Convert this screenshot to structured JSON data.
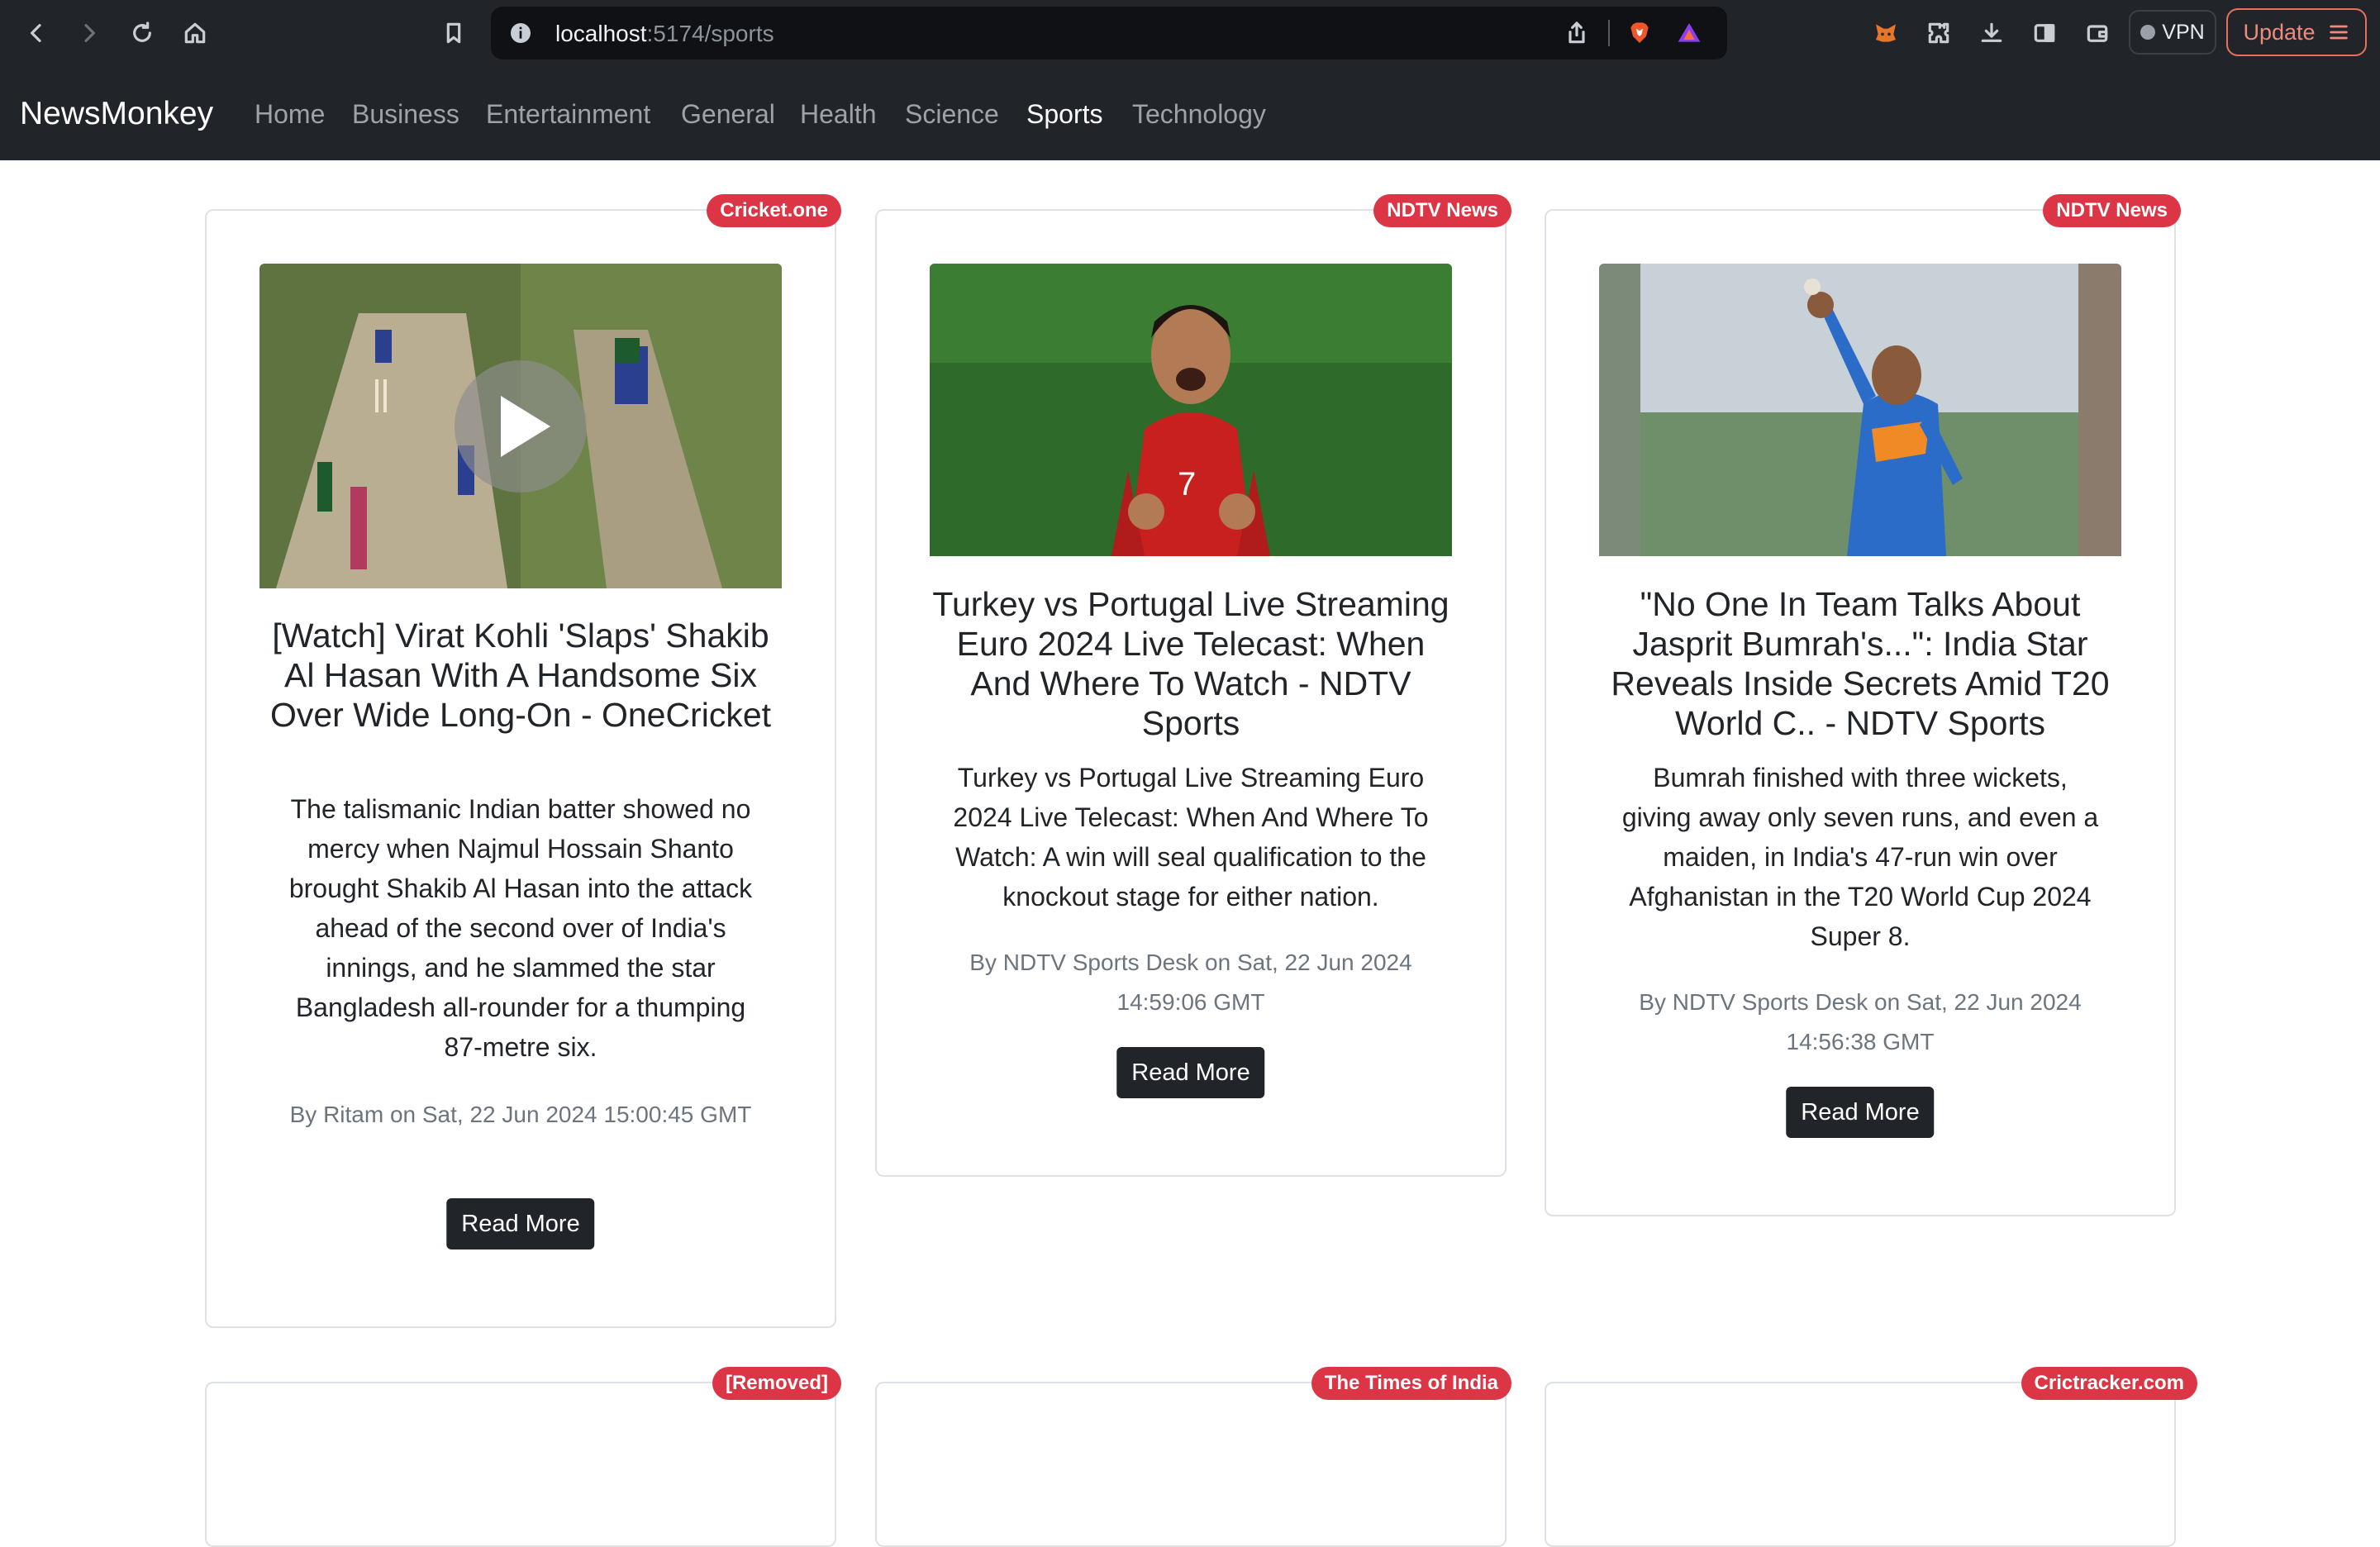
{
  "browser": {
    "url_host": "localhost",
    "url_path": ":5174/sports",
    "vpn_label": "VPN",
    "update_label": "Update"
  },
  "navbar": {
    "brand": "NewsMonkey",
    "links": [
      "Home",
      "Business",
      "Entertainment",
      "General",
      "Health",
      "Science",
      "Sports",
      "Technology"
    ],
    "active": "Sports"
  },
  "articles": [
    {
      "source": "Cricket.one",
      "title": "[Watch] Virat Kohli 'Slaps' Shakib Al Hasan With A Handsome Six Over Wide Long-On - OneCricket",
      "description": "The talismanic Indian batter showed no mercy when Najmul Hossain Shanto brought Shakib Al Hasan into the attack ahead of the second over of India's innings, and he slammed the star Bangladesh all-rounder for a thumping 87-metre six.",
      "meta": "By Ritam on Sat, 22 Jun 2024 15:00:45 GMT",
      "button": "Read More"
    },
    {
      "source": "NDTV News",
      "title": "Turkey vs Portugal Live Streaming Euro 2024 Live Telecast: When And Where To Watch - NDTV Sports",
      "description": "Turkey vs Portugal Live Streaming Euro 2024 Live Telecast: When And Where To Watch: A win will seal qualification to the knockout stage for either nation.",
      "meta": "By NDTV Sports Desk on Sat, 22 Jun 2024 14:59:06 GMT",
      "button": "Read More"
    },
    {
      "source": "NDTV News",
      "title": "\"No One In Team Talks About Jasprit Bumrah's...\": India Star Reveals Inside Secrets Amid T20 World C.. - NDTV Sports",
      "description": "Bumrah finished with three wickets, giving away only seven runs, and even a maiden, in India's 47-run win over Afghanistan in the T20 World Cup 2024 Super 8.",
      "meta": "By NDTV Sports Desk on Sat, 22 Jun 2024 14:56:38 GMT",
      "button": "Read More"
    },
    {
      "source": "[Removed]"
    },
    {
      "source": "The Times of India"
    },
    {
      "source": "Crictracker.com"
    }
  ],
  "colors": {
    "navbar": "#212529",
    "badge": "#dc3545",
    "button": "#212529",
    "update_accent": "#e8705f"
  }
}
